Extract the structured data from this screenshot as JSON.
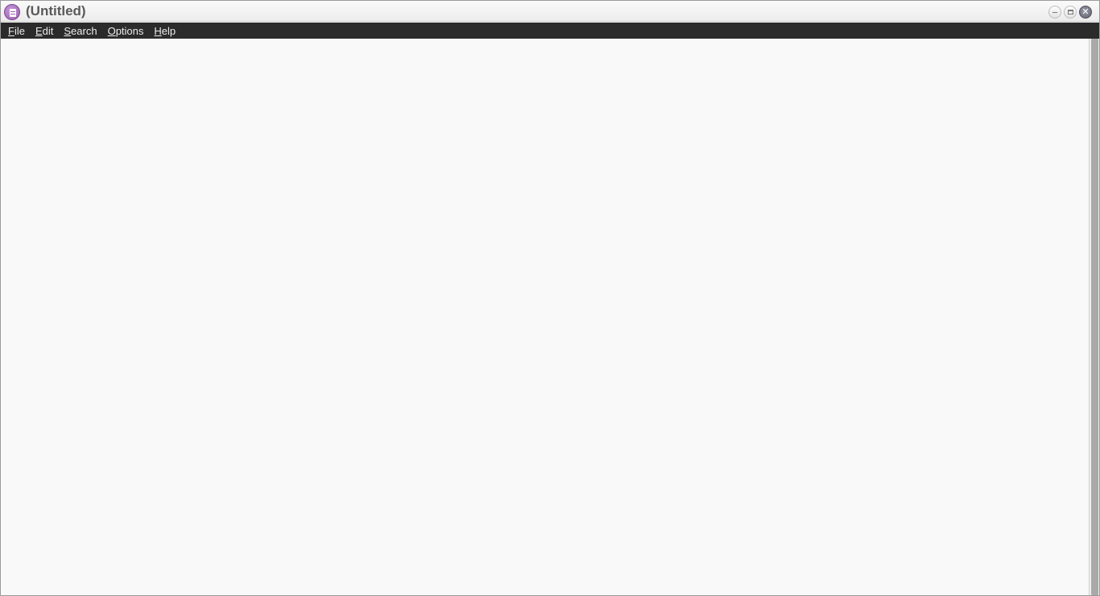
{
  "window": {
    "title": "(Untitled)",
    "icon": "notepad-icon",
    "controls": {
      "minimize_icon": "minimize-icon",
      "maximize_icon": "maximize-icon",
      "close_icon": "close-icon",
      "close_glyph": "✕"
    }
  },
  "menubar": {
    "items": [
      {
        "mnemonic": "F",
        "rest": "ile"
      },
      {
        "mnemonic": "E",
        "rest": "dit"
      },
      {
        "mnemonic": "S",
        "rest": "earch"
      },
      {
        "mnemonic": "O",
        "rest": "ptions"
      },
      {
        "mnemonic": "H",
        "rest": "elp"
      }
    ]
  },
  "editor": {
    "content": ""
  },
  "colors": {
    "menubar_bg": "#2b2b2b",
    "menubar_text": "#ececec",
    "editor_bg": "#f9f9f9",
    "app_icon_accent": "#9a5fb0",
    "scroll_thumb": "#a9a9a9"
  }
}
